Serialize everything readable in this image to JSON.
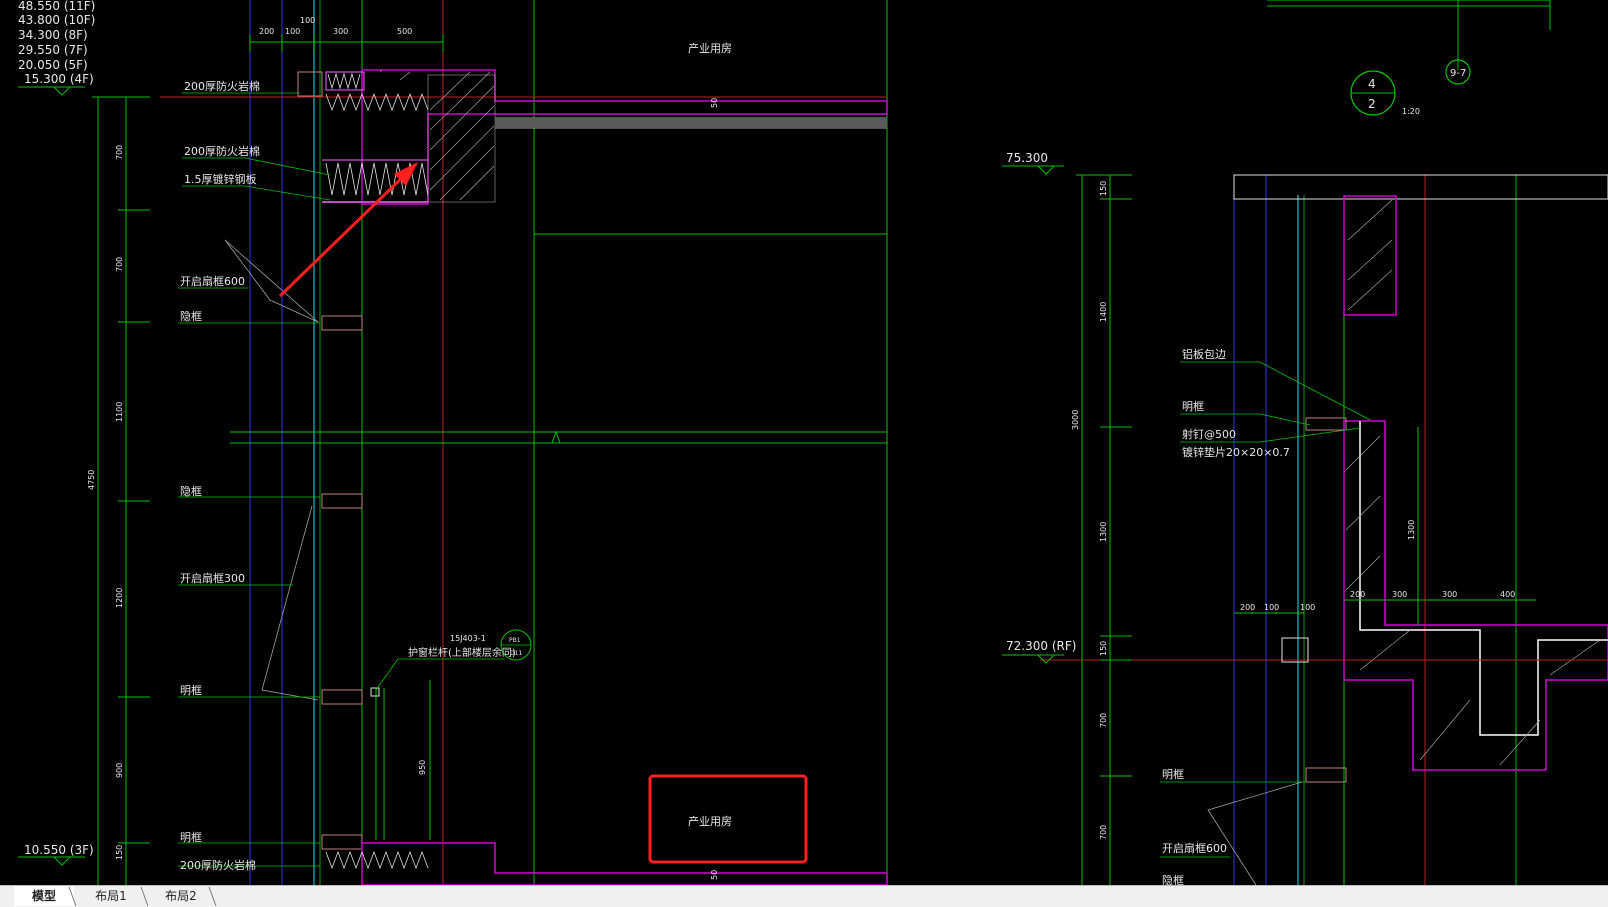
{
  "levels_left": [
    {
      "value": "48.550",
      "floor": "(11F)"
    },
    {
      "value": "43.800",
      "floor": "(10F)"
    },
    {
      "value": "34.300",
      "floor": "(8F)"
    },
    {
      "value": "29.550",
      "floor": "(7F)"
    },
    {
      "value": "20.050",
      "floor": "(5F)"
    },
    {
      "value": "15.300",
      "floor": "(4F)"
    }
  ],
  "level_bottom_left": {
    "value": "10.550",
    "floor": "(3F)"
  },
  "dims_top_left": [
    "200",
    "100",
    "100",
    "300",
    "500"
  ],
  "room_label_top": "产业用房",
  "room_label_bottom": "产业用房",
  "annotations_left": {
    "fireproof_1": "200厚防火岩棉",
    "fireproof_2": "200厚防火岩棉",
    "steel_plate": "1.5厚镀锌钢板",
    "window_600": "开启扇框600",
    "frame_1": "隐框",
    "frame_2": "隐框",
    "window_300": "开启扇框300",
    "frame_exposed_1": "明框",
    "frame_exposed_2": "明框",
    "fireproof_3": "200厚防火岩棉",
    "railing": "护窗栏杆(上部楼层余同)",
    "railing_ref": "15J403-1",
    "railing_tag_top": "PB1",
    "railing_tag_bottom": "D11"
  },
  "vertical_dims_left": {
    "total": "4750",
    "d1": "700",
    "d2": "700",
    "d3": "1100",
    "d4": "1200",
    "d5": "900",
    "d6": "150",
    "d_railing": "950",
    "d_50a": "50",
    "d_50b": "50"
  },
  "detail_tag": {
    "top": "4",
    "bottom": "2",
    "scale": "1:20",
    "ref": "9-7"
  },
  "levels_right": [
    {
      "value": "75.300",
      "floor": ""
    },
    {
      "value": "72.300",
      "floor": "(RF)"
    }
  ],
  "annotations_right": {
    "aluminum": "铝板包边",
    "frame_exposed_1": "明框",
    "nail": "射钉@500",
    "washer": "镀锌垫片20×20×0.7",
    "frame_exposed_2": "明框",
    "window_600": "开启扇框600",
    "frame_hidden": "隐框"
  },
  "vertical_dims_right": {
    "d150a": "150",
    "d1400": "1400",
    "d3000": "3000",
    "d1300": "1300",
    "d150b": "150",
    "d700a": "700",
    "d700b": "700",
    "d1300_inner": "1300"
  },
  "dims_right_bottom": [
    "200",
    "100",
    "100",
    "200",
    "300",
    "300",
    "400"
  ],
  "tabs": [
    "模型",
    "布局1",
    "布局2"
  ],
  "active_tab": "模型",
  "colors": {
    "background": "#000000",
    "green_line": "#00c000",
    "magenta": "#d000d0",
    "red_line": "#d02020",
    "highlight": "#ff2020",
    "text": "#e8e8e8"
  }
}
